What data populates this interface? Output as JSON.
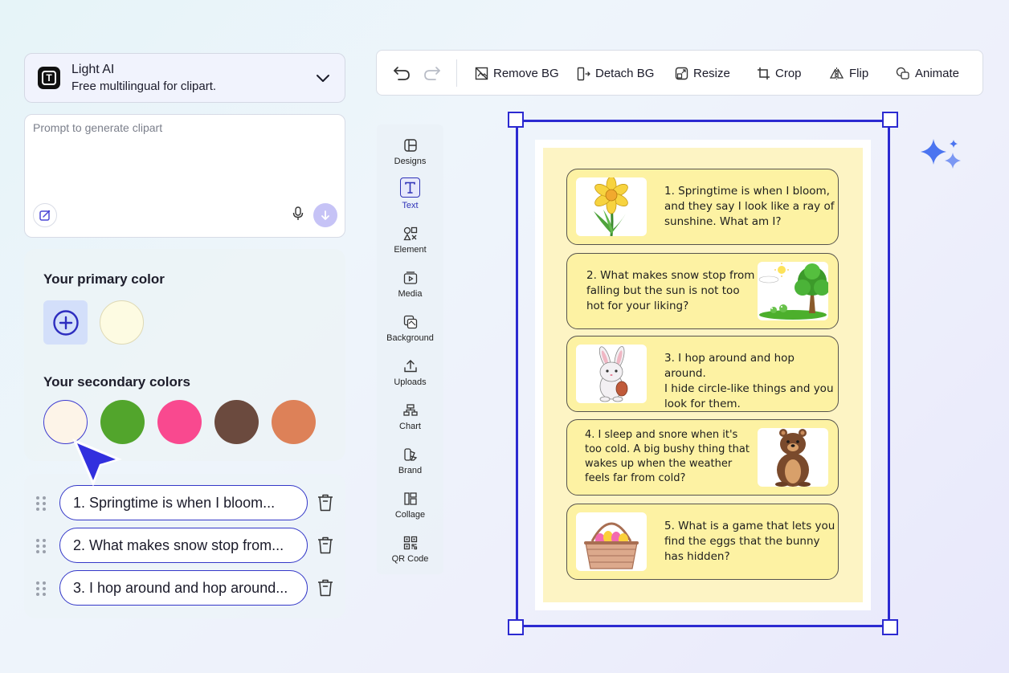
{
  "model": {
    "name": "Light AI",
    "description": "Free multilingual for clipart."
  },
  "prompt": {
    "placeholder": "Prompt to generate clipart",
    "value": ""
  },
  "colors": {
    "primary_heading": "Your primary color",
    "primary": "#fdfbe2",
    "secondary_heading": "Your secondary colors",
    "secondary": [
      "#fdf4e8",
      "#52a52c",
      "#f9498f",
      "#6b4a3e",
      "#dd8158"
    ]
  },
  "riddle_list": [
    "1. Springtime is when I bloom...",
    "2. What makes snow stop from...",
    "3. I hop around and hop around..."
  ],
  "toolbar": {
    "remove_bg": "Remove BG",
    "detach_bg": "Detach BG",
    "resize": "Resize",
    "crop": "Crop",
    "flip": "Flip",
    "animate": "Animate"
  },
  "sidebar": {
    "items": [
      "Designs",
      "Text",
      "Element",
      "Media",
      "Background",
      "Uploads",
      "Chart",
      "Brand",
      "Collage",
      "QR Code"
    ],
    "active": "Text"
  },
  "cards": [
    {
      "lines": [
        "1. Springtime is when I bloom,",
        "and they say I look like a ray of",
        "sunshine. What am I?"
      ],
      "image": "daffodil-flower"
    },
    {
      "lines": [
        "2. What makes snow stop from",
        "falling but the sun is not too",
        "hot for your liking?"
      ],
      "image": "tree-and-sun"
    },
    {
      "lines": [
        "3. I hop around and hop around.",
        "I hide circle-like things and you",
        "look for them."
      ],
      "image": "bunny-with-egg"
    },
    {
      "lines": [
        "4. I sleep and snore when it's",
        "too cold. A big bushy thing that",
        "wakes up when the weather",
        "feels far from cold?"
      ],
      "image": "brown-bear"
    },
    {
      "lines": [
        "5. What is a game that lets you",
        "find the eggs that the bunny",
        "has hidden?"
      ],
      "image": "egg-basket"
    }
  ],
  "accent_color": "#2c2ad1"
}
